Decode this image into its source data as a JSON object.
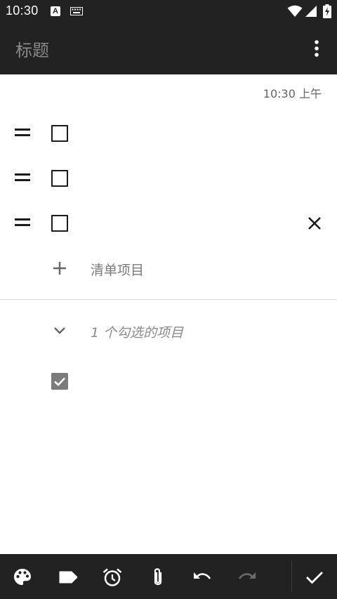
{
  "status_bar": {
    "time": "10:30",
    "notification_icon_letter": "A",
    "icons": [
      "a-notification-icon",
      "keyboard-icon",
      "wifi-icon",
      "signal-icon",
      "battery-charging-icon"
    ]
  },
  "app_bar": {
    "title": "标题",
    "menu_icon": "more-vert-icon"
  },
  "note": {
    "timestamp": "10:30 上午",
    "unchecked_items": [
      {
        "text": "",
        "checked": false
      },
      {
        "text": "",
        "checked": false
      },
      {
        "text": "",
        "checked": false
      }
    ],
    "add_item_label": "清单项目",
    "checked_header": "1 个勾选的项目",
    "checked_items": [
      {
        "text": "",
        "checked": true
      }
    ]
  },
  "bottom_bar": {
    "icons": [
      "palette-icon",
      "label-icon",
      "alarm-icon",
      "attach-icon",
      "undo-icon",
      "redo-icon",
      "done-icon"
    ]
  },
  "colors": {
    "bar_background": "#222222",
    "title_text": "#8a8a8a",
    "checked_box": "#7b7b7b",
    "divider": "#d8d8d8"
  }
}
